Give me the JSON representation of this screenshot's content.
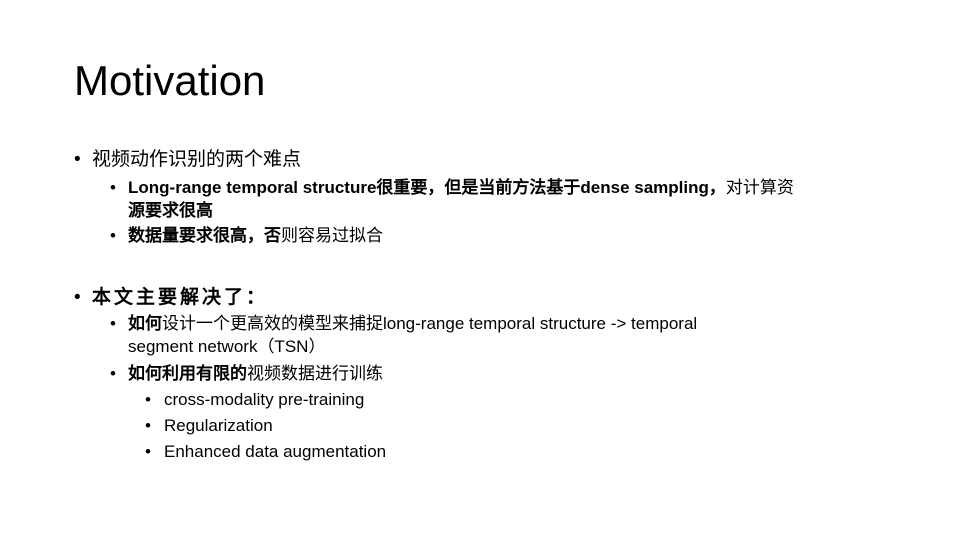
{
  "slide": {
    "title": "Motivation",
    "bullet_glyph": "•",
    "sections": [
      {
        "text": "视频动作识别的两个难点",
        "items": [
          {
            "parts": [
              {
                "text": "Long-range temporal structure很重要，但是当前方法基于dense  sampling，",
                "bold": true
              },
              {
                "text": "对计算资",
                "bold": false
              }
            ],
            "continuation": "源要求很高"
          },
          {
            "parts": [
              {
                "text": "数据量要求很高，否",
                "bold": true
              },
              {
                "text": "则容易过拟合",
                "bold": false
              }
            ]
          }
        ]
      },
      {
        "text": "本文主要解决了：",
        "items": [
          {
            "parts": [
              {
                "text": "如何",
                "bold": true
              },
              {
                "text": "设计一个更高效的模型来捕捉",
                "bold": false
              },
              {
                "text": "long-range  temporal  structure  -> temporal",
                "bold": false
              }
            ],
            "continuation": "segment  network（TSN）"
          },
          {
            "parts": [
              {
                "text": "如何利用有限的",
                "bold": true
              },
              {
                "text": "视频数据进行训练",
                "bold": false
              }
            ],
            "subitems": [
              "cross-modality pre-training",
              "Regularization",
              "Enhanced  data  augmentation"
            ]
          }
        ]
      }
    ]
  }
}
